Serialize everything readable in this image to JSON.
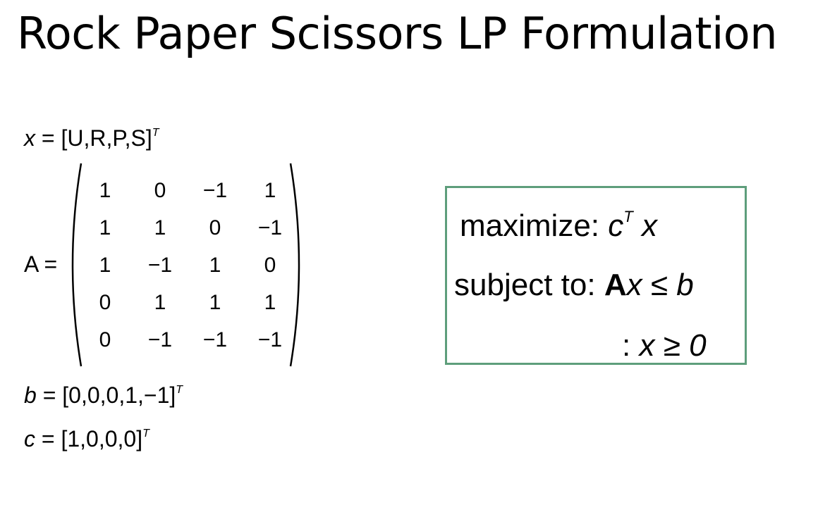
{
  "slide": {
    "title": "Rock Paper Scissors LP Formulation"
  },
  "definitions": {
    "x_lhs": "x",
    "x_rhs": "= [U,R,P,S]",
    "x_sup": "T",
    "a_label": "A =",
    "b_lhs": "b",
    "b_rhs": "= [0,0,0,1,−1]",
    "b_sup": "T",
    "c_lhs": "c",
    "c_rhs": "= [1,0,0,0]",
    "c_sup": "T"
  },
  "matrix_A": [
    [
      "1",
      "0",
      "−1",
      "1"
    ],
    [
      "1",
      "1",
      "0",
      "−1"
    ],
    [
      "1",
      "−1",
      "1",
      "0"
    ],
    [
      "0",
      "1",
      "1",
      "1"
    ],
    [
      "0",
      "−1",
      "−1",
      "−1"
    ]
  ],
  "lp": {
    "objective_word": "maximize",
    "colon": ":",
    "objective_c": "c",
    "objective_sup": "T",
    "objective_x": "x",
    "constraint_word": "subject to",
    "constraint_A": "A",
    "constraint_rest": "x ≤ b",
    "nonneg": "x ≥ 0"
  },
  "colors": {
    "box_border": "#5e9e7b"
  }
}
